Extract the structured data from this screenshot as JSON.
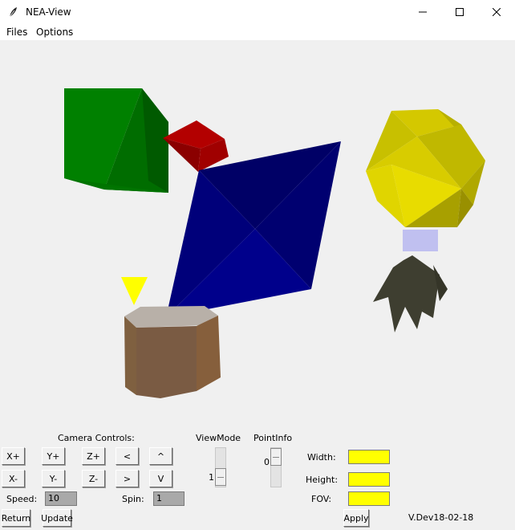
{
  "window": {
    "title": "NEA-View",
    "icon": "feather-icon"
  },
  "menu": {
    "items": [
      "Files",
      "Options"
    ]
  },
  "controls": {
    "camera_label": "Camera Controls:",
    "move_buttons": {
      "x_plus": "X+",
      "x_minus": "X-",
      "y_plus": "Y+",
      "y_minus": "Y-",
      "z_plus": "Z+",
      "z_minus": "Z-"
    },
    "rotate_buttons": {
      "left": "<",
      "right": ">",
      "up": "^",
      "down": "V"
    },
    "speed_label": "Speed:",
    "speed_value": "10",
    "spin_label": "Spin:",
    "spin_value": "1",
    "viewmode_label": "ViewMode",
    "viewmode_value": "1",
    "pointinfo_label": "PointInfo",
    "pointinfo_value": "0",
    "width_label": "Width:",
    "height_label": "Height:",
    "fov_label": "FOV:",
    "return_label": "Return",
    "update_label": "Update",
    "apply_label": "Apply",
    "version": "V.Dev18-02-18"
  },
  "colors": {
    "field_yellow": "#ffff00",
    "field_gray": "#a9a9a9"
  }
}
